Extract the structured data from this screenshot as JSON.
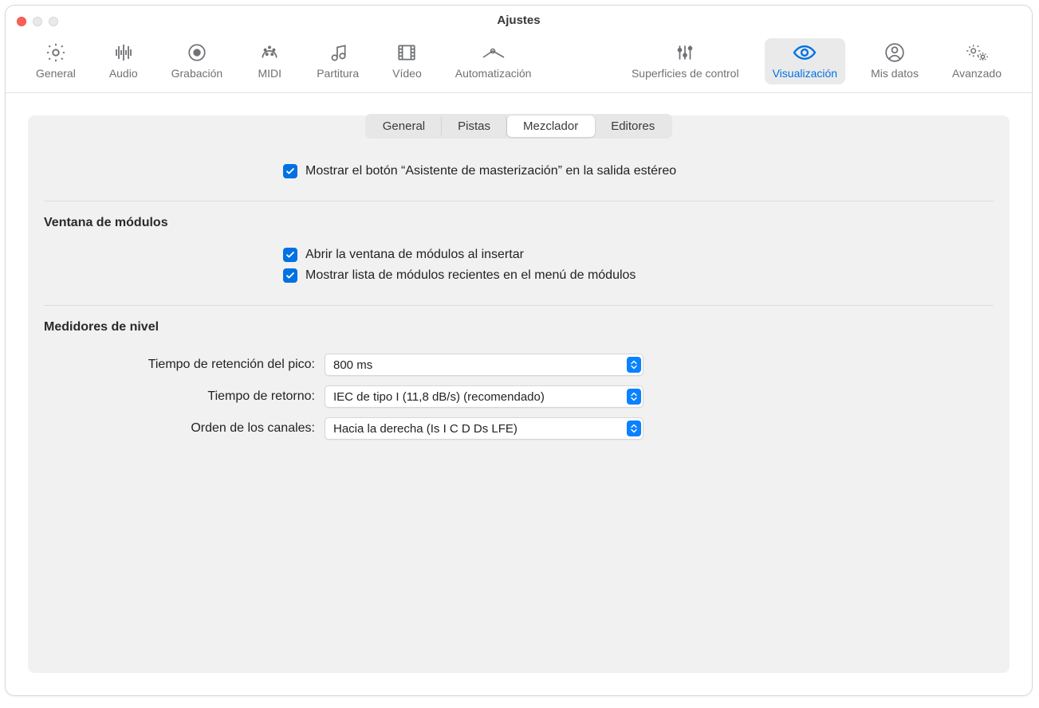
{
  "window": {
    "title": "Ajustes"
  },
  "toolbar": {
    "items": [
      {
        "label": "General"
      },
      {
        "label": "Audio"
      },
      {
        "label": "Grabación"
      },
      {
        "label": "MIDI"
      },
      {
        "label": "Partitura"
      },
      {
        "label": "Vídeo"
      },
      {
        "label": "Automatización"
      }
    ],
    "itemsRight": [
      {
        "label": "Superficies de control"
      },
      {
        "label": "Visualización"
      },
      {
        "label": "Mis datos"
      },
      {
        "label": "Avanzado"
      }
    ]
  },
  "subtabs": {
    "general": "General",
    "pistas": "Pistas",
    "mezclador": "Mezclador",
    "editores": "Editores"
  },
  "checkboxes": {
    "mastering": "Mostrar el botón “Asistente de masterización” en la salida estéreo",
    "openPlugin": "Abrir la ventana de módulos al insertar",
    "recentList": "Mostrar lista de módulos recientes en el menú de módulos"
  },
  "sections": {
    "modules": "Ventana de módulos",
    "meters": "Medidores de nivel"
  },
  "selects": {
    "peakHold": {
      "label": "Tiempo de retención del pico:",
      "value": "800 ms"
    },
    "returnTime": {
      "label": "Tiempo de retorno:",
      "value": "IEC de tipo I (11,8 dB/s) (recomendado)"
    },
    "channelOrder": {
      "label": "Orden de los canales:",
      "value": "Hacia la derecha (Is I C D Ds LFE)"
    }
  }
}
